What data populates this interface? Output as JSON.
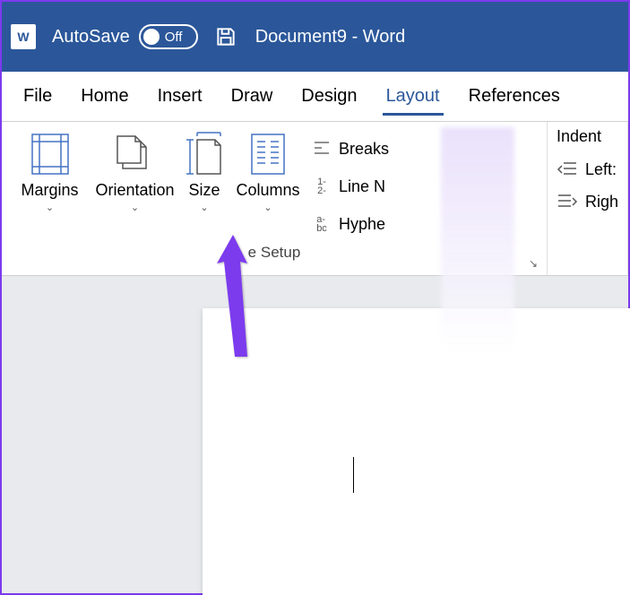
{
  "titlebar": {
    "autosave_label": "AutoSave",
    "toggle_state": "Off",
    "document_title": "Document9  -  Word"
  },
  "tabs": {
    "file": "File",
    "home": "Home",
    "insert": "Insert",
    "draw": "Draw",
    "design": "Design",
    "layout": "Layout",
    "references": "References"
  },
  "ribbon": {
    "page_setup": {
      "margins": "Margins",
      "orientation": "Orientation",
      "size": "Size",
      "columns": "Columns",
      "breaks": "Breaks",
      "line_numbers": "Line N",
      "hyphenation": "Hyphe",
      "group_label": "e Setup"
    },
    "paragraph": {
      "indent_label": "Indent",
      "left": "Left:",
      "right": "Righ"
    }
  }
}
